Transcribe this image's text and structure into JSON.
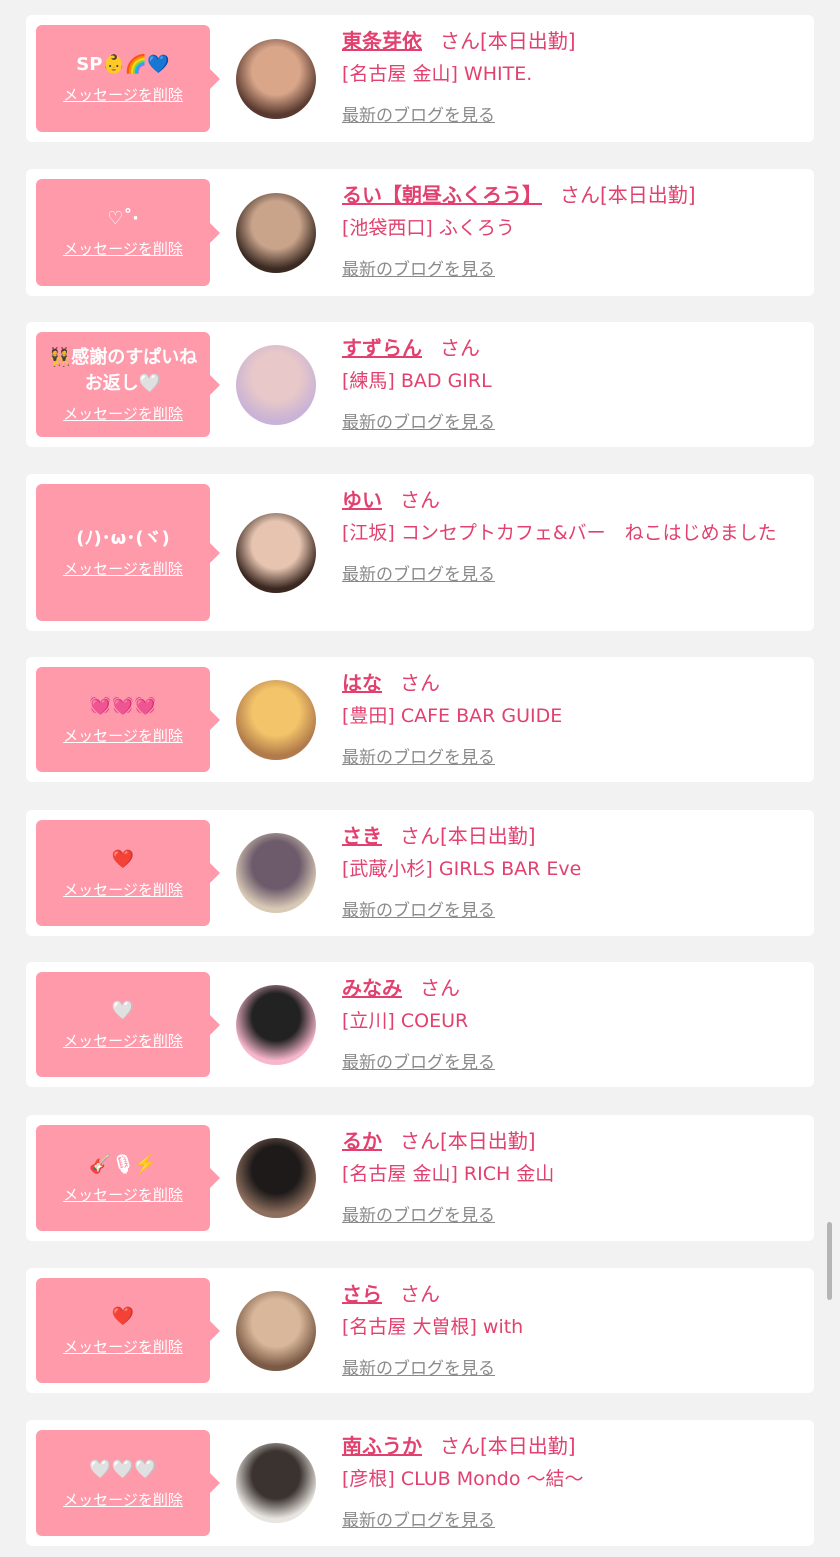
{
  "delete_label": "メッセージを削除",
  "blog_label": "最新のブログを見る",
  "san_label": "さん",
  "cards": [
    {
      "message": "SP👶🌈💙",
      "name": "東条芽依",
      "status": "[本日出勤]",
      "shop": "[名古屋 金山] WHITE.",
      "avatar_colors": [
        "#5a3a30",
        "#d9a68a"
      ]
    },
    {
      "message": "♡˚‧",
      "name": "るい【朝昼ふくろう】",
      "status": "[本日出勤]",
      "shop": "[池袋西口] ふくろう",
      "avatar_colors": [
        "#3b2a22",
        "#c9a48b"
      ]
    },
    {
      "message": "👯感謝のすぱいね\nお返し🤍",
      "name": "すずらん",
      "status": "",
      "shop": "[練馬] BAD GIRL",
      "avatar_colors": [
        "#c9b3d6",
        "#e8c8c8"
      ]
    },
    {
      "message": "(ﾉ)･ω･(ヾ)",
      "name": "ゆい",
      "status": "",
      "shop": "[江坂] コンセプトカフェ&バー　ねこはじめました",
      "avatar_colors": [
        "#3a2720",
        "#e6c4b0"
      ]
    },
    {
      "message": "💓💓💓",
      "name": "はな",
      "status": "",
      "shop": "[豊田] CAFE BAR GUIDE",
      "avatar_colors": [
        "#b07a4a",
        "#f3c46a"
      ]
    },
    {
      "message": "❤️",
      "name": "さき",
      "status": "[本日出勤]",
      "shop": "[武蔵小杉] GIRLS BAR Eve",
      "avatar_colors": [
        "#d8c9b5",
        "#6d5b6b"
      ]
    },
    {
      "message": "🤍",
      "name": "みなみ",
      "status": "",
      "shop": "[立川] COEUR",
      "avatar_colors": [
        "#f7b6cc",
        "#222222"
      ]
    },
    {
      "message": "🎸🎙⚡️",
      "name": "るか",
      "status": "[本日出勤]",
      "shop": "[名古屋 金山] RICH 金山",
      "avatar_colors": [
        "#8e6f5e",
        "#1e1a1a"
      ]
    },
    {
      "message": "❤️",
      "name": "さら",
      "status": "",
      "shop": "[名古屋 大曽根] with",
      "avatar_colors": [
        "#7a5a45",
        "#d8b79a"
      ]
    },
    {
      "message": "🤍🤍🤍",
      "name": "南ふうか",
      "status": "[本日出勤]",
      "shop": "[彦根] CLUB Mondo 〜結〜",
      "avatar_colors": [
        "#e8e4df",
        "#3a3330"
      ]
    }
  ]
}
